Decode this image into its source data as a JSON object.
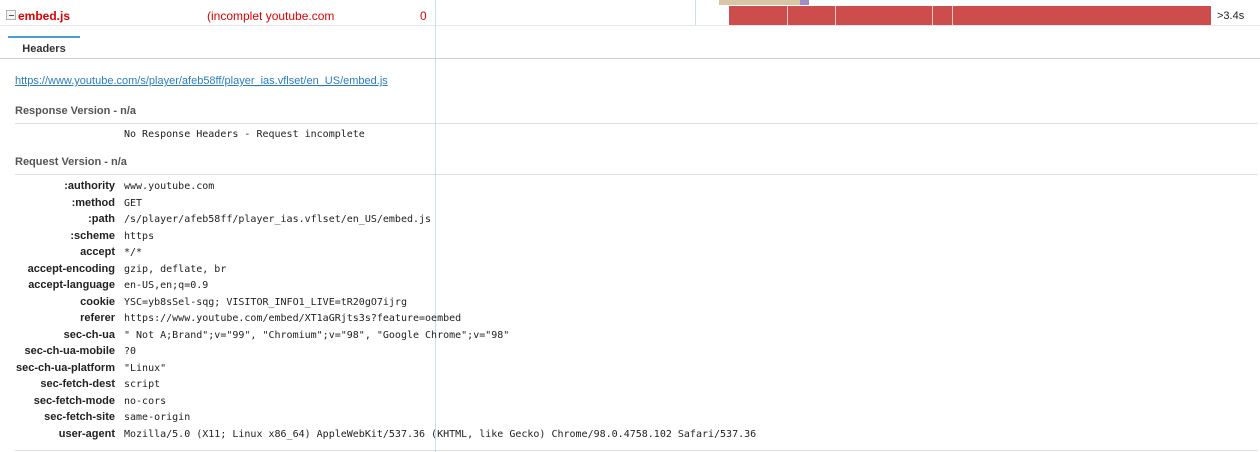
{
  "request": {
    "name": "embed.js",
    "status": "(incomplet youtube.com",
    "size": "0",
    "time": ">3.4s"
  },
  "colors": {
    "error_red": "#d00000",
    "waterfall_bar": "#cd4c4c",
    "link_blue": "#2a7cc1",
    "tab_accent": "#4a9bd6"
  },
  "tabs": [
    {
      "label": "Headers"
    }
  ],
  "url": "https://www.youtube.com/s/player/afeb58ff/player_ias.vflset/en_US/embed.js",
  "response": {
    "title": "Response Version - n/a",
    "message": "No Response Headers - Request incomplete"
  },
  "request_headers": {
    "title": "Request Version - n/a",
    "items": [
      {
        "key": ":authority",
        "value": "www.youtube.com"
      },
      {
        "key": ":method",
        "value": "GET"
      },
      {
        "key": ":path",
        "value": "/s/player/afeb58ff/player_ias.vflset/en_US/embed.js"
      },
      {
        "key": ":scheme",
        "value": "https"
      },
      {
        "key": "accept",
        "value": "*/*"
      },
      {
        "key": "accept-encoding",
        "value": "gzip, deflate, br"
      },
      {
        "key": "accept-language",
        "value": "en-US,en;q=0.9"
      },
      {
        "key": "cookie",
        "value": "YSC=yb8sSel-sqg; VISITOR_INFO1_LIVE=tR20gO7ijrg"
      },
      {
        "key": "referer",
        "value": "https://www.youtube.com/embed/XT1aGRjts3s?feature=oembed"
      },
      {
        "key": "sec-ch-ua",
        "value": "\" Not A;Brand\";v=\"99\", \"Chromium\";v=\"98\", \"Google Chrome\";v=\"98\""
      },
      {
        "key": "sec-ch-ua-mobile",
        "value": "?0"
      },
      {
        "key": "sec-ch-ua-platform",
        "value": "\"Linux\""
      },
      {
        "key": "sec-fetch-dest",
        "value": "script"
      },
      {
        "key": "sec-fetch-mode",
        "value": "no-cors"
      },
      {
        "key": "sec-fetch-site",
        "value": "same-origin"
      },
      {
        "key": "user-agent",
        "value": "Mozilla/5.0 (X11; Linux x86_64) AppleWebKit/537.36 (KHTML, like Gecko) Chrome/98.0.4758.102 Safari/537.36"
      }
    ]
  }
}
